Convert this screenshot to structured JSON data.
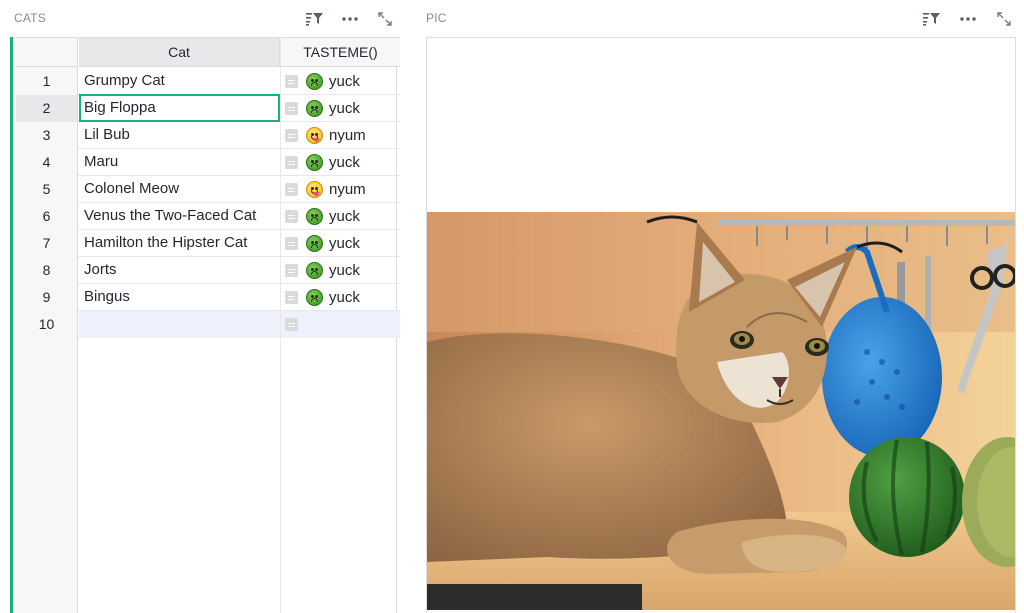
{
  "left_widget": {
    "title": "CATS",
    "icons": [
      "sort-filter-icon",
      "more-options-icon",
      "expand-icon"
    ]
  },
  "right_widget": {
    "title": "PIC",
    "icons": [
      "sort-filter-icon",
      "more-options-icon",
      "expand-icon"
    ]
  },
  "table": {
    "columns": [
      "Cat",
      "TASTEME()"
    ],
    "rows": [
      {
        "num": "1",
        "cat": "Grumpy Cat",
        "taste": "yuck",
        "emoji": "sick"
      },
      {
        "num": "2",
        "cat": "Big Floppa",
        "taste": "yuck",
        "emoji": "sick"
      },
      {
        "num": "3",
        "cat": "Lil Bub",
        "taste": "nyum",
        "emoji": "yum"
      },
      {
        "num": "4",
        "cat": "Maru",
        "taste": "yuck",
        "emoji": "sick"
      },
      {
        "num": "5",
        "cat": "Colonel Meow",
        "taste": "nyum",
        "emoji": "yum"
      },
      {
        "num": "6",
        "cat": "Venus the Two-Faced Cat",
        "taste": "yuck",
        "emoji": "sick"
      },
      {
        "num": "7",
        "cat": "Hamilton the Hipster Cat",
        "taste": "yuck",
        "emoji": "sick"
      },
      {
        "num": "8",
        "cat": "Jorts",
        "taste": "yuck",
        "emoji": "sick"
      },
      {
        "num": "9",
        "cat": "Bingus",
        "taste": "yuck",
        "emoji": "sick"
      },
      {
        "num": "10",
        "cat": "",
        "taste": "",
        "emoji": ""
      }
    ],
    "selected_row": "2",
    "selected_column": "Cat"
  },
  "colors": {
    "accent": "#16b378",
    "new_row": "#eef0fb",
    "row_number_bg": "#f7f7f7"
  },
  "picture": {
    "subject": "caracal-cat-photo"
  }
}
